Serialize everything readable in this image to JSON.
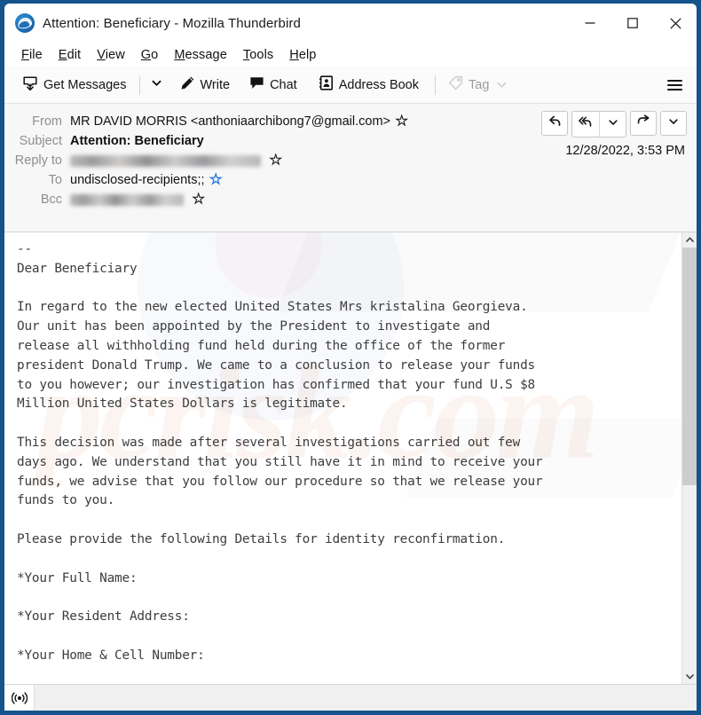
{
  "window": {
    "title": "Attention: Beneficiary - Mozilla Thunderbird",
    "logo_icon": "thunderbird-logo-icon",
    "controls": {
      "minimize": "minimize-icon",
      "maximize": "maximize-icon",
      "close": "close-icon"
    }
  },
  "menu_bar": {
    "items": [
      {
        "label": "File",
        "accel": "F"
      },
      {
        "label": "Edit",
        "accel": "E"
      },
      {
        "label": "View",
        "accel": "V"
      },
      {
        "label": "Go",
        "accel": "G"
      },
      {
        "label": "Message",
        "accel": "M"
      },
      {
        "label": "Tools",
        "accel": "T"
      },
      {
        "label": "Help",
        "accel": "H"
      }
    ]
  },
  "toolbar": {
    "get_messages_label": "Get Messages",
    "get_messages_icon": "inbox-download-icon",
    "get_messages_caret_icon": "chevron-down-icon",
    "write_label": "Write",
    "write_icon": "pencil-icon",
    "chat_label": "Chat",
    "chat_icon": "speech-bubble-icon",
    "address_book_label": "Address Book",
    "address_book_icon": "contact-card-icon",
    "tag_label": "Tag",
    "tag_icon": "tag-icon",
    "tag_caret_icon": "chevron-down-icon",
    "tag_disabled": true,
    "app_menu_icon": "hamburger-menu-icon"
  },
  "message_header": {
    "from_label": "From",
    "from_value": "MR DAVID MORRIS <anthoniaarchibong7@gmail.com>",
    "from_star_icon": "star-outline-icon",
    "subject_label": "Subject",
    "subject_value": "Attention: Beneficiary",
    "reply_to_label": "Reply to",
    "reply_to_value": "",
    "reply_to_redacted": true,
    "reply_to_star_icon": "star-outline-icon",
    "to_label": "To",
    "to_value": "undisclosed-recipients;;",
    "to_star_icon": "star-filled-blue-icon",
    "bcc_label": "Bcc",
    "bcc_value": "",
    "bcc_redacted": true,
    "bcc_star_icon": "star-outline-icon",
    "date": "12/28/2022, 3:53 PM",
    "actions": {
      "reply_icon": "reply-arrow-icon",
      "reply_all_icon": "reply-all-arrow-icon",
      "reply_all_caret_icon": "chevron-down-icon",
      "forward_icon": "forward-arrow-icon",
      "more_caret_icon": "chevron-down-icon"
    }
  },
  "message_body": {
    "lines": [
      "--",
      "Dear Beneficiary",
      "",
      "In regard to the new elected United States Mrs kristalina Georgieva.",
      "Our unit has been appointed by the President to investigate and",
      "release all withholding fund held during the office of the former",
      "president Donald Trump. We came to a conclusion to release your funds",
      "to you however; our investigation has confirmed that your fund U.S $8",
      "Million United States Dollars is legitimate.",
      "",
      "This decision was made after several investigations carried out few",
      "days ago. We understand that you still have it in mind to receive your",
      "funds, we advise that you follow our procedure so that we release your",
      "funds to you.",
      "",
      "Please provide the following Details for identity reconfirmation.",
      "",
      "*Your Full Name:",
      "",
      "*Your Resident Address:",
      "",
      "*Your Home & Cell Number:"
    ],
    "watermark_text": "pcrisk.com"
  },
  "scrollbar": {
    "up_arrow_icon": "chevron-up-icon",
    "down_arrow_icon": "chevron-down-icon"
  },
  "status_bar": {
    "icon": "broadcast-signal-icon",
    "text": ""
  },
  "colors": {
    "window_border": "#15538c",
    "toolbar_bg": "#fbfbfb",
    "header_bg": "#f7f7f7",
    "body_bg": "#ffffff",
    "star_blue": "#2b7cd3",
    "label_grey": "#8e8e8e"
  }
}
